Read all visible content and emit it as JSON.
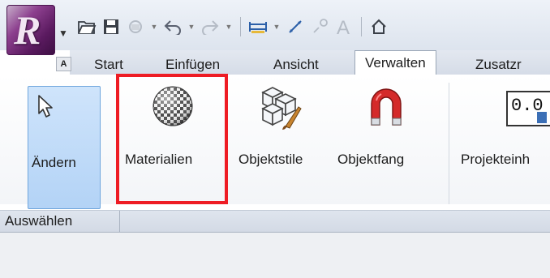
{
  "app": {
    "logo_letter": "R",
    "logo_badge": "A"
  },
  "tabs": [
    {
      "label": "Start"
    },
    {
      "label": "Einfügen"
    },
    {
      "label": "Ansicht"
    },
    {
      "label": "Verwalten",
      "active": true
    },
    {
      "label": "Zusatzr"
    }
  ],
  "tools": {
    "andern": {
      "label": "Ändern",
      "icon": "cursor-arrow-icon"
    },
    "materialien": {
      "label": "Materialien",
      "icon": "material-sphere-icon"
    },
    "objektstile": {
      "label": "Objektstile",
      "icon": "object-styles-icon"
    },
    "objektfang": {
      "label": "Objektfang",
      "icon": "magnet-icon"
    },
    "projekteinh": {
      "label": "Projekteinh",
      "icon": "project-units-icon",
      "icon_text": "0.0"
    }
  },
  "panel": {
    "title": "Auswählen"
  },
  "colors": {
    "highlight": "#ee1c24",
    "active_tool": "#b3d3f6"
  }
}
